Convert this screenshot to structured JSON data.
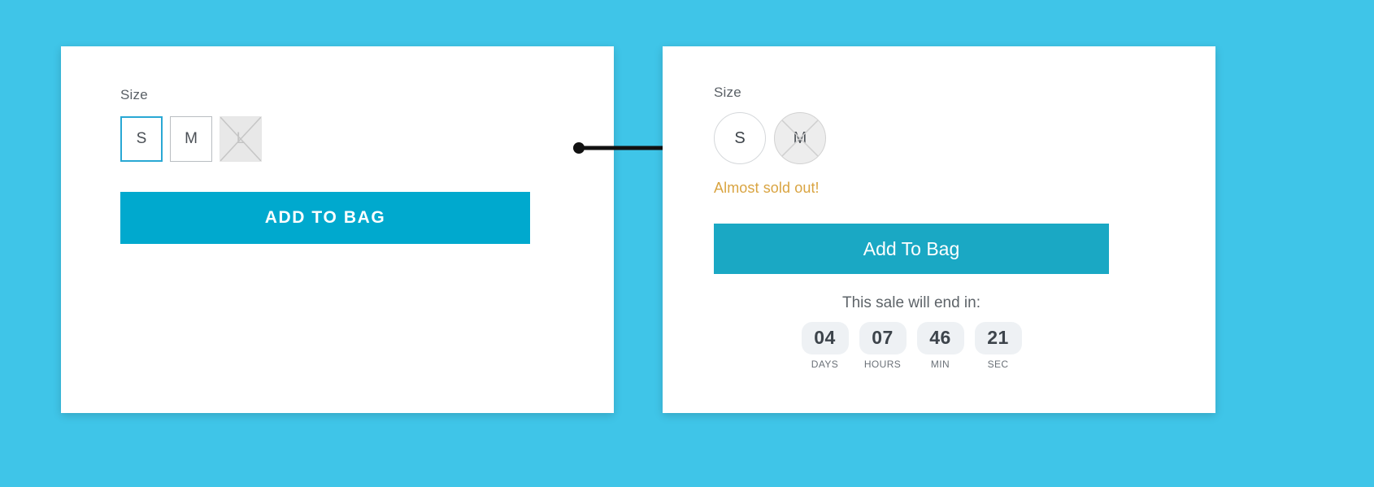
{
  "background_color": "#3fc5e8",
  "accent_color_before": "#00a9ce",
  "accent_color_after": "#1aa8c4",
  "warning_color": "#d9a441",
  "before": {
    "size_label": "Size",
    "sizes": [
      {
        "label": "S",
        "state": "selected"
      },
      {
        "label": "M",
        "state": "available"
      },
      {
        "label": "L",
        "state": "disabled"
      }
    ],
    "add_to_bag_label": "ADD TO BAG"
  },
  "after": {
    "size_label": "Size",
    "sizes": [
      {
        "label": "S",
        "state": "available"
      },
      {
        "label": "M",
        "state": "soldout"
      }
    ],
    "warning_text": "Almost sold out!",
    "add_to_bag_label": "Add To Bag",
    "countdown": {
      "title": "This sale will end in:",
      "units": [
        {
          "value": "04",
          "name": "DAYS"
        },
        {
          "value": "07",
          "name": "HOURS"
        },
        {
          "value": "46",
          "name": "MIN"
        },
        {
          "value": "21",
          "name": "SEC"
        }
      ]
    }
  }
}
